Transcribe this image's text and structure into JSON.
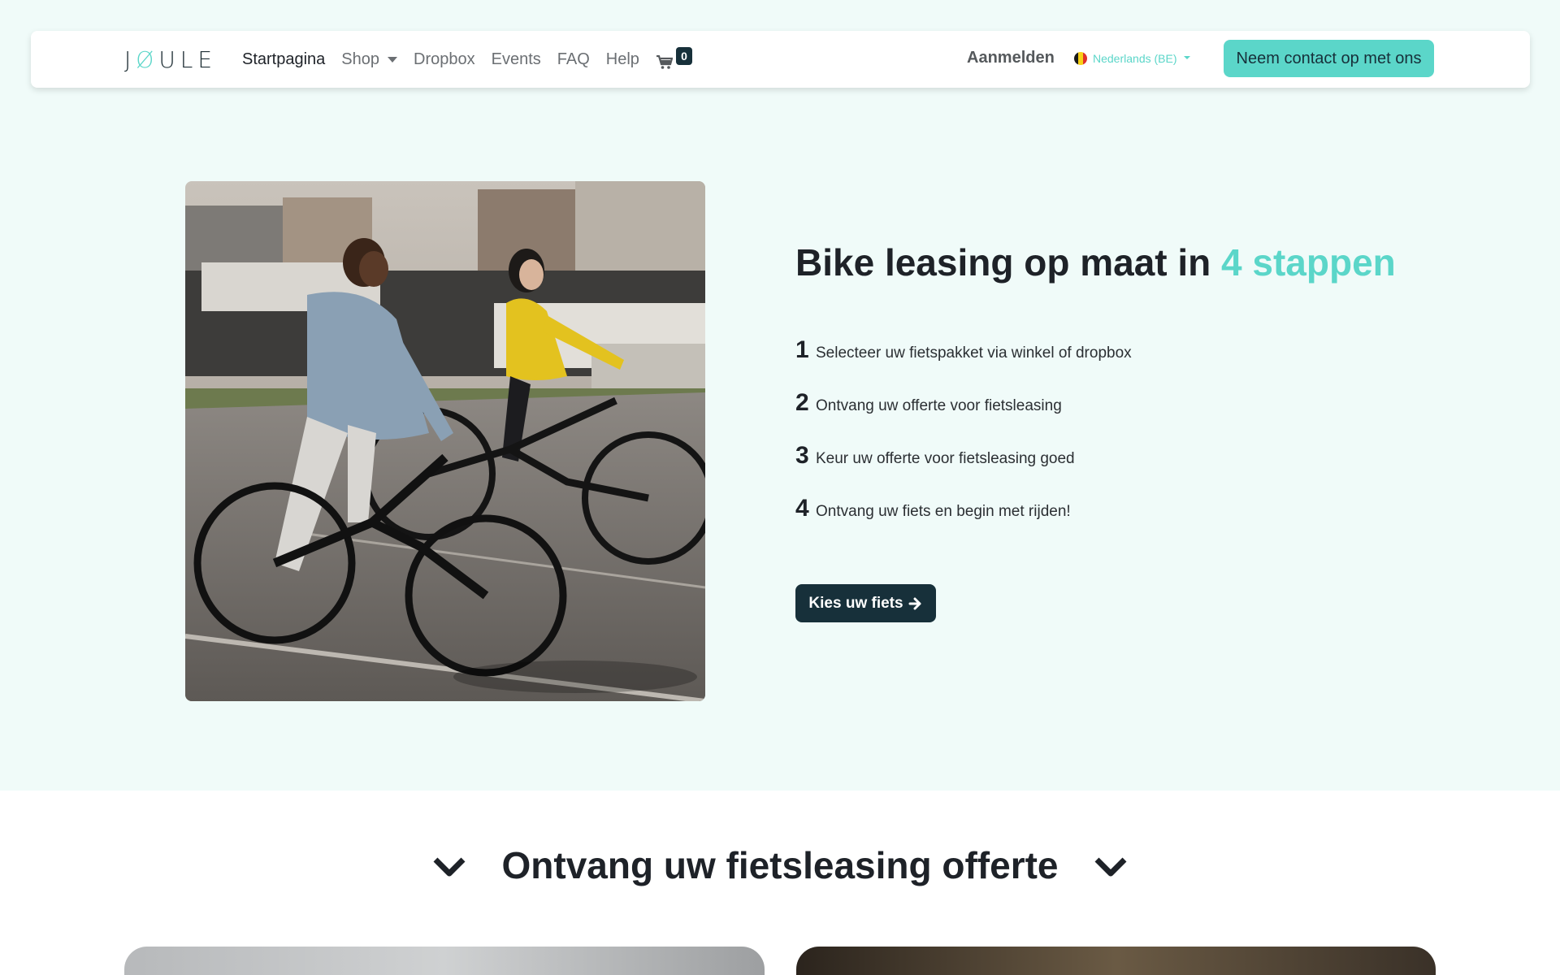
{
  "nav": {
    "logo": {
      "left": "J",
      "o": "Ø",
      "right": "ULE"
    },
    "links": [
      {
        "label": "Startpagina",
        "active": true
      },
      {
        "label": "Shop",
        "dropdown": true
      },
      {
        "label": "Dropbox"
      },
      {
        "label": "Events"
      },
      {
        "label": "FAQ"
      },
      {
        "label": "Help"
      }
    ],
    "cart_count": "0",
    "login": "Aanmelden",
    "language": "Nederlands (BE)",
    "contact": "Neem contact op met ons"
  },
  "hero": {
    "title_main": "Bike leasing op maat in",
    "title_accent": "4 stappen",
    "steps": [
      {
        "num": "1",
        "text": "Selecteer uw fietspakket via winkel of dropbox"
      },
      {
        "num": "2",
        "text": "Ontvang uw offerte voor fietsleasing"
      },
      {
        "num": "3",
        "text": "Keur uw offerte voor fietsleasing goed"
      },
      {
        "num": "4",
        "text": "Ontvang uw fiets en begin met rijden!"
      }
    ],
    "cta": "Kies uw fiets"
  },
  "offer": {
    "title": "Ontvang uw fietsleasing offerte"
  },
  "colors": {
    "accent": "#5bd6c9",
    "dark": "#17303a",
    "background": "#f0fbf9"
  }
}
